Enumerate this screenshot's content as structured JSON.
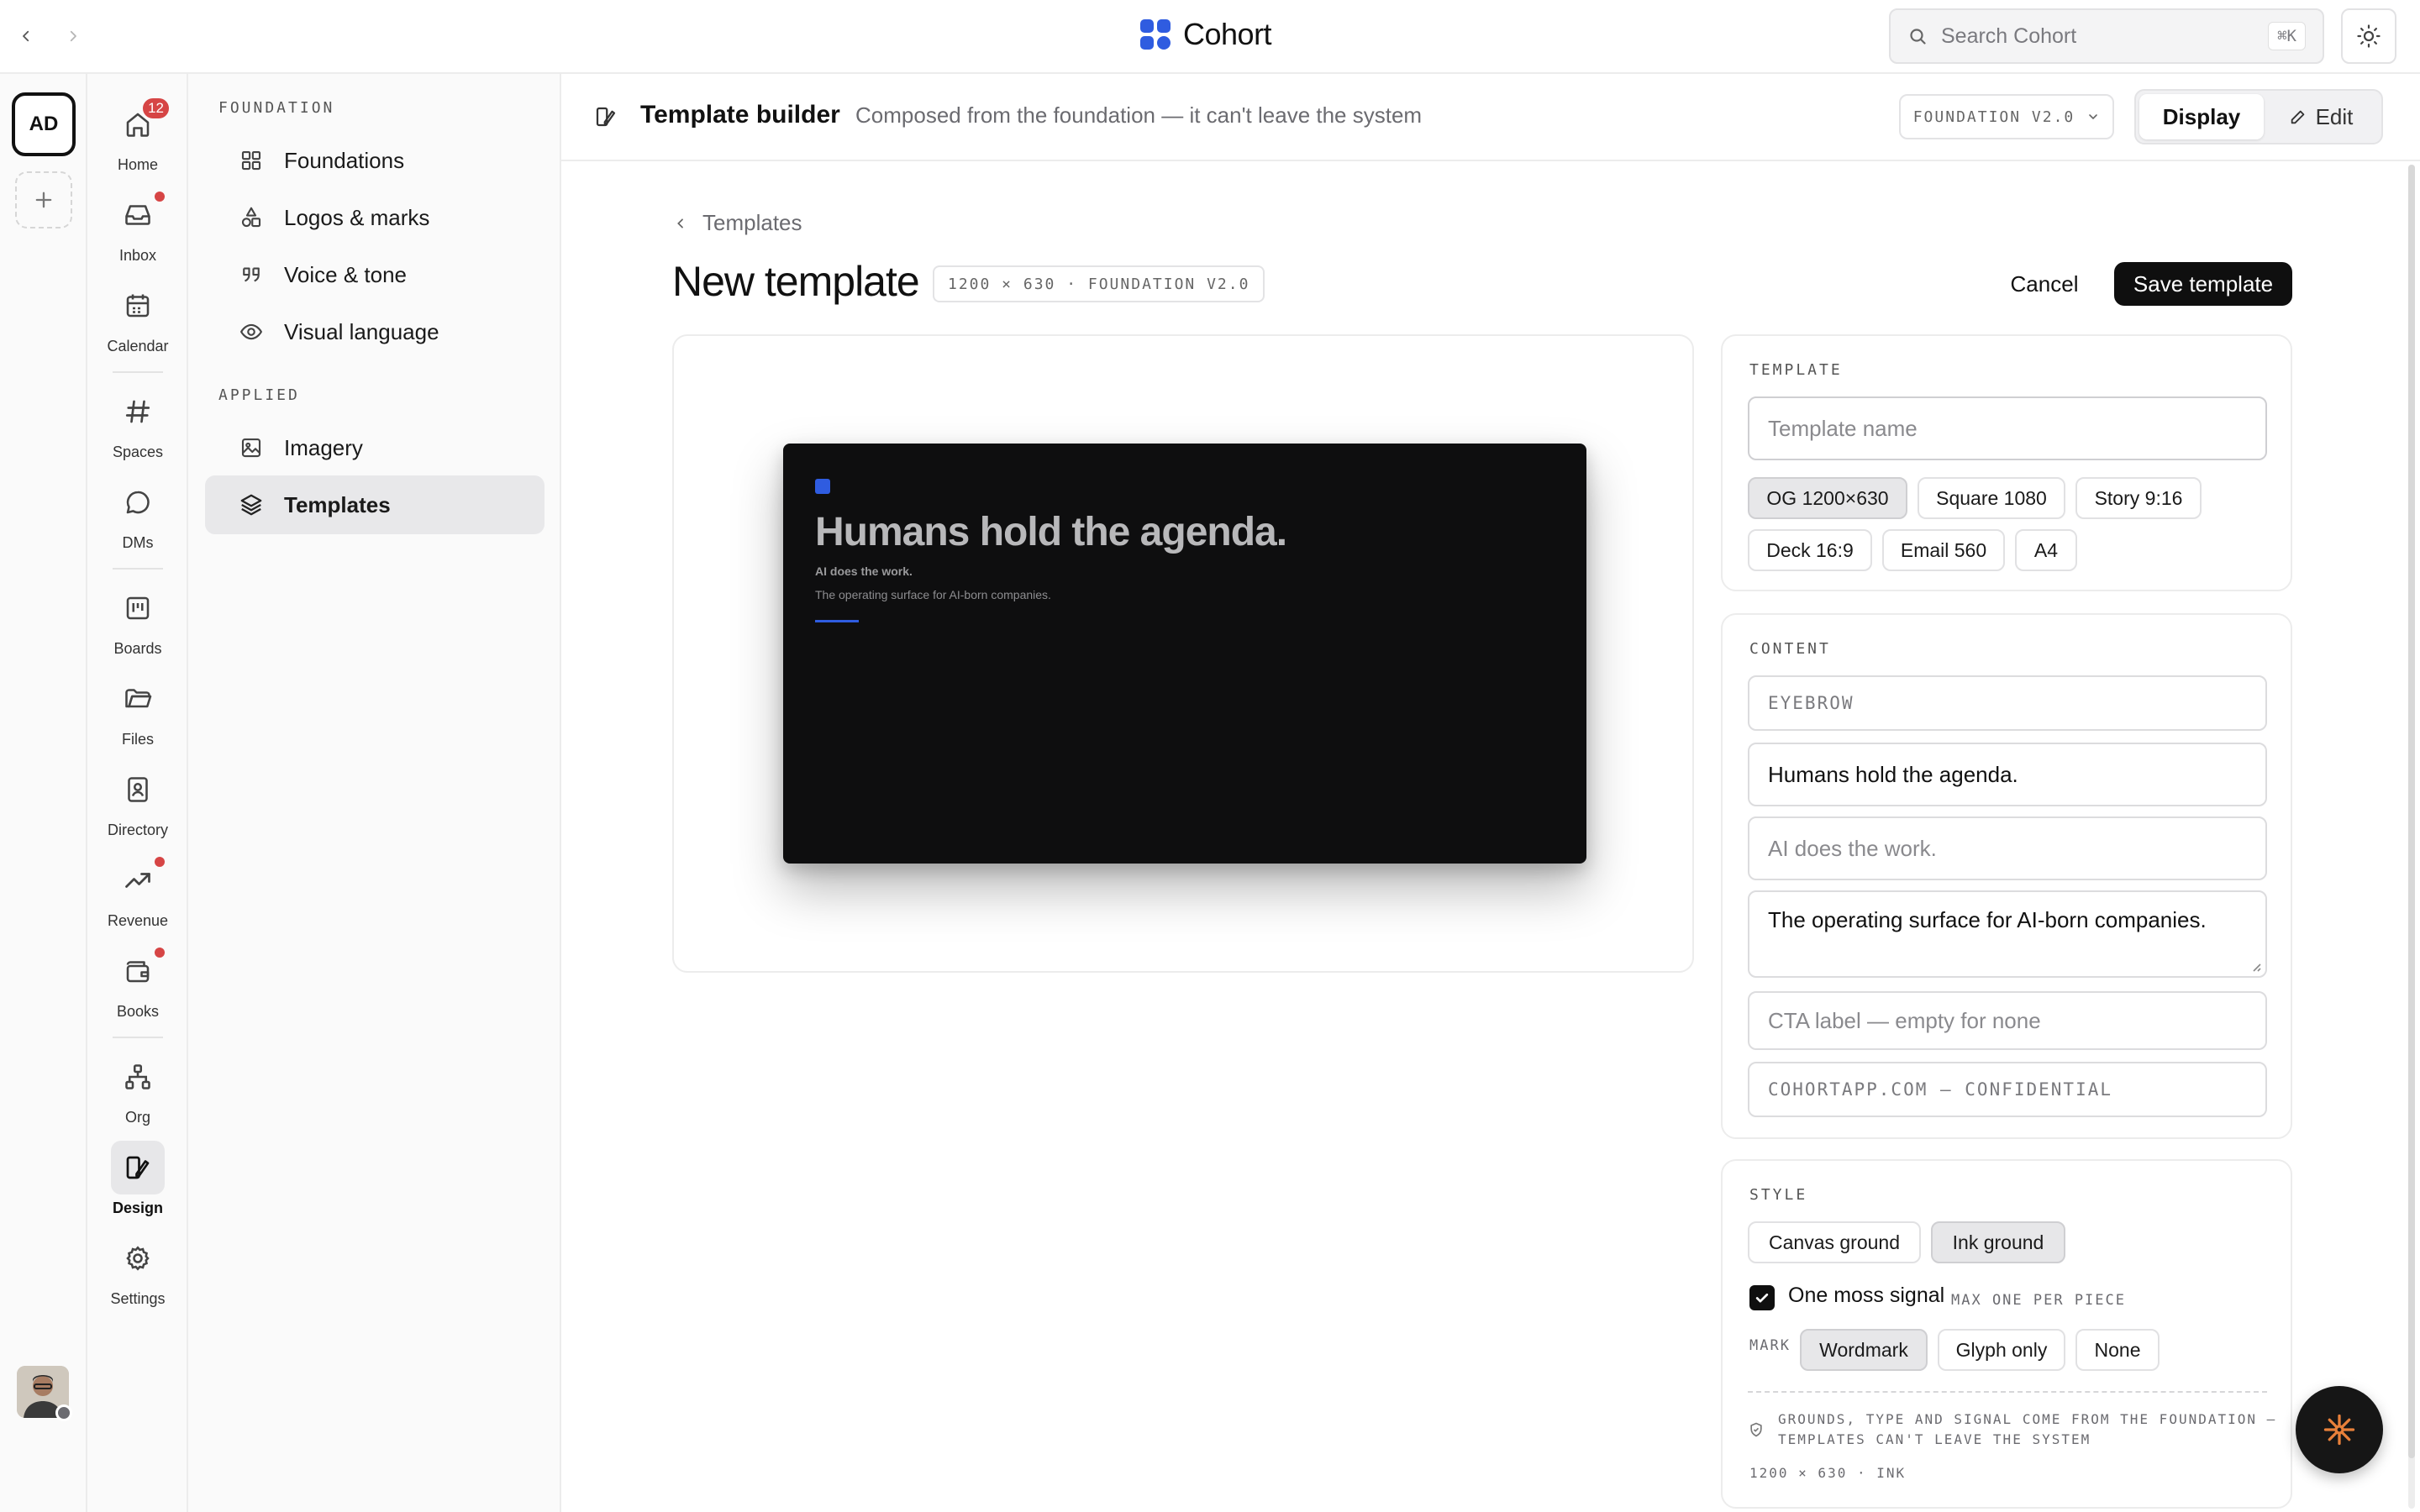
{
  "topbar": {
    "brand": "Cohort",
    "search_placeholder": "Search Cohort",
    "search_shortcut": "⌘K",
    "icons": {
      "back": "chevron-left-icon",
      "forward": "chevron-right-icon",
      "search": "search-icon",
      "theme": "sun-icon"
    },
    "brand_color": "#2f5ce0"
  },
  "workspace": {
    "initials": "AD"
  },
  "rail": {
    "items": [
      {
        "label": "Home",
        "icon": "home-icon",
        "badge": "12"
      },
      {
        "label": "Inbox",
        "icon": "inbox-icon",
        "dot": true
      },
      {
        "label": "Calendar",
        "icon": "calendar-icon"
      },
      {
        "label": "Spaces",
        "icon": "hash-icon"
      },
      {
        "label": "DMs",
        "icon": "chat-icon"
      },
      {
        "label": "Boards",
        "icon": "board-icon"
      },
      {
        "label": "Files",
        "icon": "folder-icon"
      },
      {
        "label": "Directory",
        "icon": "contact-icon"
      },
      {
        "label": "Revenue",
        "icon": "trend-icon",
        "dot": true
      },
      {
        "label": "Books",
        "icon": "wallet-icon",
        "dot": true
      },
      {
        "label": "Org",
        "icon": "org-icon"
      },
      {
        "label": "Design",
        "icon": "design-icon",
        "active": true
      },
      {
        "label": "Settings",
        "icon": "gear-icon"
      }
    ]
  },
  "sidebar": {
    "foundation_heading": "FOUNDATION",
    "foundation_items": [
      {
        "label": "Foundations",
        "icon": "grid-icon"
      },
      {
        "label": "Logos & marks",
        "icon": "shapes-icon"
      },
      {
        "label": "Voice & tone",
        "icon": "quote-icon"
      },
      {
        "label": "Visual language",
        "icon": "eye-icon"
      }
    ],
    "applied_heading": "APPLIED",
    "applied_items": [
      {
        "label": "Imagery",
        "icon": "image-icon"
      },
      {
        "label": "Templates",
        "icon": "layers-icon",
        "active": true
      }
    ]
  },
  "header": {
    "title": "Template builder",
    "subtitle": "Composed from the foundation — it can't leave the system",
    "version": "FOUNDATION V2.0",
    "display_label": "Display",
    "edit_label": "Edit"
  },
  "page": {
    "breadcrumb": "Templates",
    "title": "New template",
    "dimension_chip": "1200 × 630 · FOUNDATION V2.0",
    "cancel_label": "Cancel",
    "save_label": "Save template"
  },
  "preview": {
    "headline": "Humans hold the agenda.",
    "eyebrow": "AI does the work.",
    "subline": "The operating surface for AI-born companies.",
    "accent_color": "#2f5ce0",
    "ground_color": "#0e0e0f"
  },
  "template_panel": {
    "heading": "TEMPLATE",
    "name_placeholder": "Template name",
    "formats": [
      "OG 1200×630",
      "Square 1080",
      "Story 9:16",
      "Deck 16:9",
      "Email 560",
      "A4"
    ],
    "selected_format": "OG 1200×630"
  },
  "content_panel": {
    "heading": "CONTENT",
    "eyebrow_placeholder": "EYEBROW",
    "headline_value": "Humans hold the agenda.",
    "subhead_value": "AI does the work.",
    "body_value": "The operating surface for AI-born companies.",
    "cta_placeholder": "CTA label — empty for none",
    "footer_placeholder": "COHORTAPP.COM — CONFIDENTIAL"
  },
  "style_panel": {
    "heading": "STYLE",
    "grounds": [
      "Canvas ground",
      "Ink ground"
    ],
    "selected_ground": "Ink ground",
    "signal_label": "One moss signal",
    "signal_note": "MAX ONE PER PIECE",
    "signal_checked": true,
    "mark_label": "MARK",
    "marks": [
      "Wordmark",
      "Glyph only",
      "None"
    ],
    "selected_mark": "Wordmark",
    "footnote_line1": "GROUNDS, TYPE AND SIGNAL COME FROM THE FOUNDATION —",
    "footnote_line2": "TEMPLATES CAN'T LEAVE THE SYSTEM",
    "spec": "1200 × 630 · INK"
  },
  "assistant": {
    "icon": "sparkle-icon",
    "accent": "#e8803a"
  }
}
